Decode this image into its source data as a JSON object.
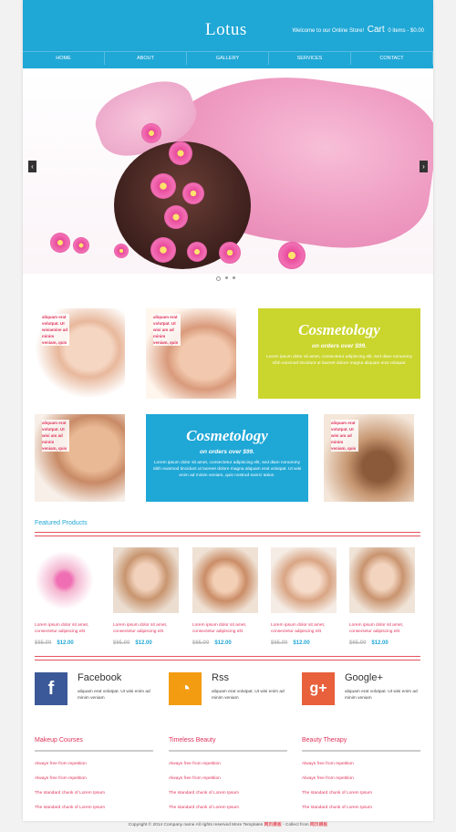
{
  "header": {
    "logo": "Lotus",
    "welcome": "Welcome to our Online Store!",
    "cart_label": "Cart",
    "cart_summary": "0 items - $0.00"
  },
  "nav": [
    "HOME",
    "ABOUT",
    "GALLERY",
    "SERVICES",
    "CONTACT"
  ],
  "slider": {
    "slides": 3,
    "active": 1
  },
  "tiles": {
    "short_text": "aliquam erat volutpat. Ut wisiamine ad minim veniam, quis",
    "narrow_text": "aliquam erat volutpat. Ut wisi am ad minim veniam, quis"
  },
  "promo1": {
    "title": "Cosmetology",
    "sub": "on orders over $99.",
    "body": "Lorem ipsum dolor sit amet, consectetur adipiscing elit, sed diam nonummy nibh euismod tincidunt ut laoreet dolore magna aliquam erat volutpat."
  },
  "promo2": {
    "title": "Cosmetology",
    "sub": "on orders over $99.",
    "body": "Lorem ipsum dolor sit amet, consectetur adipiscing elit, sed diam nonummy nibh euismod tincidunt ut laoreet dolore magna aliquam erat volutpat. Ut wisi enim ad minim veniam, quis nostrud exerci tation."
  },
  "featured_title": "Featured Products",
  "products": [
    {
      "text": "Lorem ipsum dolor sit amet, consectetur adipiscing elit",
      "old": "$65.00",
      "new": "$12.00"
    },
    {
      "text": "Lorem ipsum dolor sit amet, consectetur adipiscing elit",
      "old": "$65.00",
      "new": "$12.00"
    },
    {
      "text": "Lorem ipsum dolor sit amet, consectetur adipiscing elit",
      "old": "$65.00",
      "new": "$12.00"
    },
    {
      "text": "Lorem ipsum dolor sit amet, consectetur adipiscing elit",
      "old": "$65.00",
      "new": "$12.00"
    },
    {
      "text": "Lorem ipsum dolor sit amet, consectetur adipiscing elit",
      "old": "$65.00",
      "new": "$12.00"
    }
  ],
  "social": [
    {
      "name": "Facebook",
      "icon": "facebook-icon",
      "glyph": "f",
      "color": "#3b5998",
      "text": "aliquam erat volutpat. Ut wisi enim ad minim veniam"
    },
    {
      "name": "Rss",
      "icon": "rss-icon",
      "glyph": "◔",
      "color": "#f39c12",
      "text": "aliquam erat volutpat. Ut wisi enim ad minim veniam"
    },
    {
      "name": "Google+",
      "icon": "google-plus-icon",
      "glyph": "g+",
      "color": "#e8603c",
      "text": "aliquam erat volutpat. Ut wisi enim ad minim veniam"
    }
  ],
  "footer": [
    {
      "title": "Makeup Courses",
      "links": [
        "Always free from repetition",
        "Always free from repetition",
        "The standard chunk of Lorem Ipsum",
        "The standard chunk of Lorem Ipsum"
      ]
    },
    {
      "title": "Timeless Beauty",
      "links": [
        "Always free from repetition",
        "Always free from repetition",
        "The standard chunk of Lorem Ipsum",
        "The standard chunk of Lorem Ipsum"
      ]
    },
    {
      "title": "Beauty Therapy",
      "links": [
        "Always free from repetition",
        "Always free from repetition",
        "The standard chunk of Lorem Ipsum",
        "The standard chunk of Lorem Ipsum"
      ]
    }
  ],
  "copyright": {
    "text": "Copyright © 2014 Company name All rights reserved More Templates",
    "link1": "网页模板",
    "sep": "- Collect from",
    "link2": "网页模板"
  }
}
